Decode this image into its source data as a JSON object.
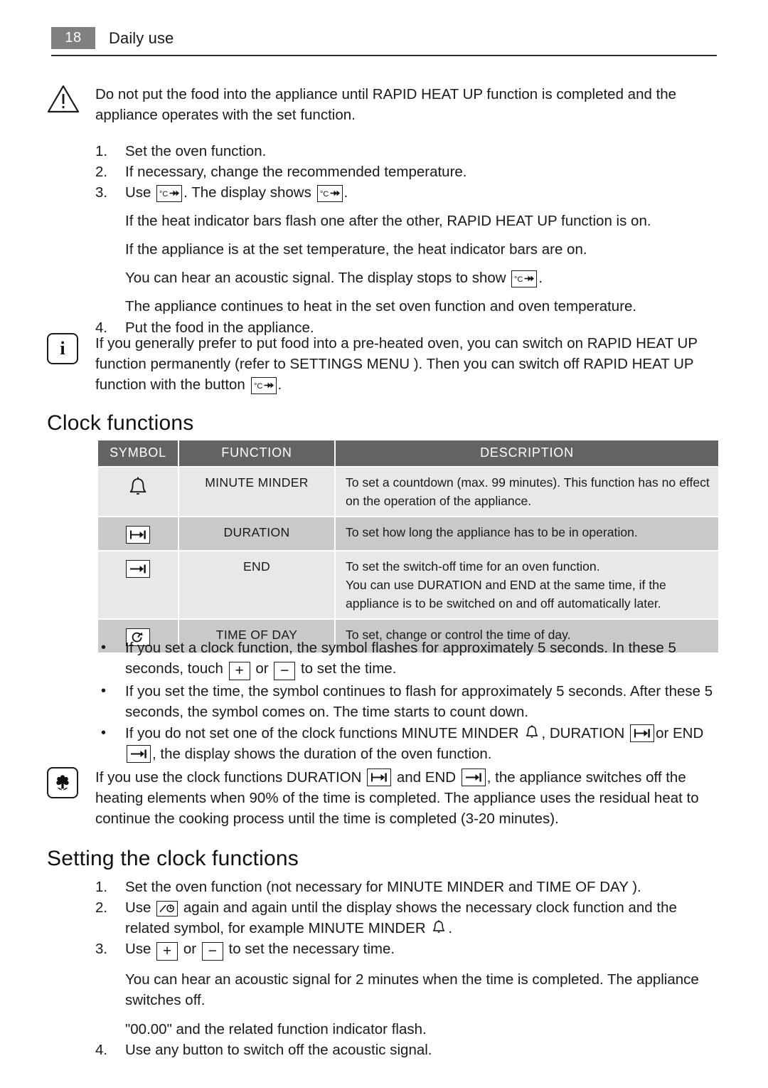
{
  "header": {
    "page_number": "18",
    "title": "Daily use"
  },
  "warning_note": {
    "icon": "warning-triangle-icon",
    "text": "Do not put the food into the appliance until RAPID HEAT UP function is completed and the appliance operates with the set function."
  },
  "rapid_steps": {
    "step1": "Set the oven function.",
    "step2": "If necessary, change the recommended temperature.",
    "step3_a": "Use",
    "step3_b": ". The display shows",
    "step3_c": ".",
    "note1": "If the heat indicator bars flash one after the other, RAPID HEAT UP function is on.",
    "note2": "If the appliance is at the set temperature, the heat indicator bars are on.",
    "note3_a": "You can hear an acoustic signal. The display stops to show",
    "note3_b": ".",
    "note4": "The appliance continues to heat in the set oven function and oven temperature.",
    "step4": "Put the food in the appliance.",
    "markers": {
      "m1": "1.",
      "m2": "2.",
      "m3": "3.",
      "m4": "4."
    }
  },
  "info_note": {
    "icon": "info-icon",
    "text_a": "If you generally prefer to put food into a pre-heated oven, you can switch on RAPID HEAT UP function permanently (refer to SETTINGS MENU ). Then you can switch off RAPID HEAT UP function with the button",
    "text_b": "."
  },
  "clock_functions": {
    "heading": "Clock functions",
    "table": {
      "columns": [
        "SYMBOL",
        "FUNCTION",
        "DESCRIPTION"
      ],
      "rows": [
        {
          "symbol": "bell-icon",
          "function": "MINUTE MINDER",
          "description": "To set a countdown (max. 99 minutes). This function has no effect on the operation of the appliance."
        },
        {
          "symbol": "duration-icon",
          "function": "DURATION",
          "description": "To set how long the appliance has to be in operation."
        },
        {
          "symbol": "end-icon",
          "function": "END",
          "description": "To set the switch-off time for an oven function.\nYou can use DURATION and END at the same time, if the appliance is to be switched on and off automatically later."
        },
        {
          "symbol": "time-of-day-icon",
          "function": "TIME OF DAY",
          "description": "To set, change or control the time of day."
        }
      ]
    },
    "bullets": {
      "b1_a": "If you set a clock function, the symbol flashes for approximately 5 seconds. In these 5 seconds, touch",
      "b1_or": "or",
      "b1_b": "to set the time.",
      "b2": "If you set the time, the symbol continues to flash for approximately 5 seconds. After these 5 seconds, the symbol comes on. The time starts to count down.",
      "b3_a": "If you do not set one of the clock functions MINUTE MINDER",
      "b3_b": ", DURATION",
      "b3_c": "or END",
      "b3_d": ", the display shows the duration of the oven function.",
      "marker": "•"
    },
    "plus_label": "+",
    "minus_label": "−"
  },
  "eco_note": {
    "icon": "eco-flower-icon",
    "text_a": "If you use the clock functions DURATION",
    "text_b": "and END",
    "text_c": ", the appliance switches off the heating elements when 90% of the time is completed. The appliance uses the residual heat to continue the cooking process until the time is completed (3-20 minutes)."
  },
  "setting_clock": {
    "heading": "Setting the clock functions",
    "step1": "Set the oven function (not necessary for MINUTE MINDER and TIME OF DAY ).",
    "step2_a": "Use",
    "step2_b": "again and again until the display shows the necessary clock function and the related symbol, for example MINUTE MINDER",
    "step2_c": ".",
    "step3_a": "Use",
    "step3_or": "or",
    "step3_b": "to set the necessary time.",
    "note1": "You can hear an acoustic signal for 2 minutes when the time is completed. The appliance switches off.",
    "note2": "\"00.00\" and the related function indicator flash.",
    "step4": "Use any button to switch off the acoustic signal.",
    "markers": {
      "m1": "1.",
      "m2": "2.",
      "m3": "3.",
      "m4": "4."
    }
  },
  "colors": {
    "page_num_bg": "#808080",
    "table_header_bg": "#636363",
    "row_light": "#e8e8e8",
    "row_dark": "#c9c9c9",
    "text": "#1a1a1a"
  }
}
